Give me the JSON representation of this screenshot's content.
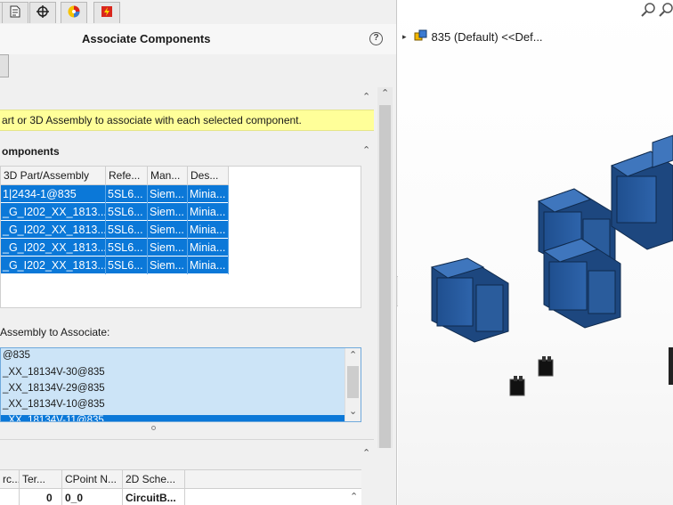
{
  "panel": {
    "title": "Associate Components",
    "help_glyph": "?",
    "message": "art or 3D Assembly to associate with each selected component.",
    "components_section": "omponents",
    "assoc_label": " Assembly to Associate:",
    "tabs": [
      {
        "icon": "feature-tree-icon"
      },
      {
        "icon": "property-manager-icon"
      },
      {
        "icon": "config-manager-icon"
      },
      {
        "icon": "appearance-icon"
      },
      {
        "icon": "electrical-icon"
      }
    ]
  },
  "components_table": {
    "columns": [
      "3D Part/Assembly",
      "Refe...",
      "Man...",
      "Des..."
    ],
    "rows": [
      {
        "part": "1|2434-1@835",
        "ref": "5SL6...",
        "man": "Siem...",
        "des": "Minia..."
      },
      {
        "part": "_G_I202_XX_1813...",
        "ref": "5SL6...",
        "man": "Siem...",
        "des": "Minia..."
      },
      {
        "part": "_G_I202_XX_1813...",
        "ref": "5SL6...",
        "man": "Siem...",
        "des": "Minia..."
      },
      {
        "part": "_G_I202_XX_1813...",
        "ref": "5SL6...",
        "man": "Siem...",
        "des": "Minia..."
      },
      {
        "part": "_G_I202_XX_1813...",
        "ref": "5SL6...",
        "man": "Siem...",
        "des": "Minia..."
      }
    ]
  },
  "assembly_list": {
    "items": [
      {
        "label": "@835",
        "selected": false
      },
      {
        "label": "_XX_18134V-30@835",
        "selected": false
      },
      {
        "label": "_XX_18134V-29@835",
        "selected": false
      },
      {
        "label": "_XX_18134V-10@835",
        "selected": false
      },
      {
        "label": "_XX_18134V-11@835",
        "selected": true
      }
    ]
  },
  "terminal_table": {
    "columns": [
      "rc...",
      "Ter...",
      "CPoint N...",
      "2D Sche..."
    ],
    "row": [
      "",
      "0",
      "0_0",
      "CircuitB..."
    ]
  },
  "viewport": {
    "tree_label": "835 (Default) <<Def...",
    "tree_arrow": "▸",
    "colors": {
      "component_blue": "#2a5c9c",
      "selection_blue": "#0b78d8",
      "message_yellow": "#ffff99"
    }
  }
}
